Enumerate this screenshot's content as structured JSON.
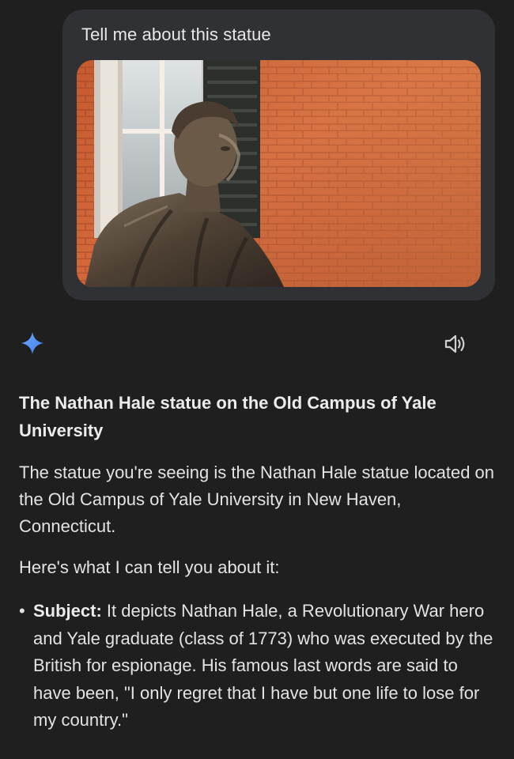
{
  "user_message": {
    "prompt": "Tell me about this statue",
    "image_alt": "Photo of a bronze statue in front of a red brick building"
  },
  "response": {
    "title": "The Nathan Hale statue on the Old Campus of Yale University",
    "paragraph1": "The statue you're seeing is the Nathan Hale statue located on the Old Campus of Yale University in New Haven, Connecticut.",
    "paragraph2": "Here's what I can tell you about it:",
    "bullets": [
      {
        "marker": "•",
        "label": "Subject:",
        "text": " It depicts Nathan Hale, a Revolutionary War hero and Yale graduate (class of 1773) who was executed by the British for espionage. His famous last words are said to have been, \"I only regret that I have but one life to lose for my country.\""
      }
    ]
  },
  "icons": {
    "assistant": "sparkle-icon",
    "read_aloud": "speaker-icon"
  },
  "colors": {
    "background": "#1f1f1f",
    "bubble": "#303134",
    "sparkle_accent": "#4b8ef0",
    "text": "#e3e3e3"
  }
}
